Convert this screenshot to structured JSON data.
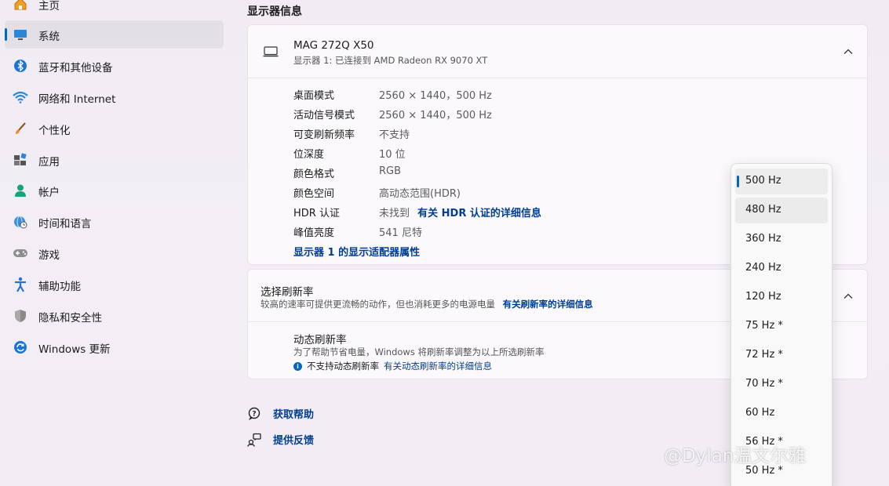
{
  "sidebar": {
    "items": [
      {
        "label": "主页",
        "icon": "home-icon"
      },
      {
        "label": "系统",
        "icon": "system-icon",
        "active": true
      },
      {
        "label": "蓝牙和其他设备",
        "icon": "bluetooth-icon"
      },
      {
        "label": "网络和 Internet",
        "icon": "wifi-icon"
      },
      {
        "label": "个性化",
        "icon": "brush-icon"
      },
      {
        "label": "应用",
        "icon": "apps-icon"
      },
      {
        "label": "帐户",
        "icon": "account-icon"
      },
      {
        "label": "时间和语言",
        "icon": "globe-clock-icon"
      },
      {
        "label": "游戏",
        "icon": "gamepad-icon"
      },
      {
        "label": "辅助功能",
        "icon": "accessibility-icon"
      },
      {
        "label": "隐私和安全性",
        "icon": "shield-icon"
      },
      {
        "label": "Windows 更新",
        "icon": "update-icon"
      }
    ]
  },
  "main": {
    "section_title": "显示器信息",
    "monitor": {
      "name": "MAG 272Q X50",
      "connection": "显示器 1: 已连接到 AMD Radeon RX 9070 XT"
    },
    "info_rows": [
      {
        "label": "桌面模式",
        "value": "2560 × 1440，500 Hz"
      },
      {
        "label": "活动信号模式",
        "value": "2560 × 1440，500 Hz"
      },
      {
        "label": "可变刷新频率",
        "value": "不支持"
      },
      {
        "label": "位深度",
        "value": "10 位"
      },
      {
        "label": "颜色格式",
        "value": "RGB"
      },
      {
        "label": "颜色空间",
        "value": "高动态范围(HDR)"
      },
      {
        "label": "HDR 认证",
        "value": "未找到",
        "link": "有关 HDR 认证的详细信息"
      },
      {
        "label": "峰值亮度",
        "value": "541 尼特"
      }
    ],
    "adapter_link": "显示器 1 的显示适配器属性",
    "refresh": {
      "title": "选择刷新率",
      "desc": "较高的速率可提供更流畅的动作，但也消耗更多的电源电量",
      "link": "有关刷新率的详细信息",
      "dynamic_title": "动态刷新率",
      "dynamic_desc": "为了帮助节省电量，Windows 将刷新率调整为以上所选刷新率",
      "dynamic_info": "不支持动态刷新率",
      "dynamic_link": "有关动态刷新率的详细信息"
    },
    "help": {
      "get_help": "获取帮助",
      "feedback": "提供反馈"
    }
  },
  "dropdown": {
    "selected": "500 Hz",
    "options": [
      "500 Hz",
      "480 Hz",
      "360 Hz",
      "240 Hz",
      "120 Hz",
      "75 Hz *",
      "72 Hz *",
      "70 Hz *",
      "60 Hz",
      "56 Hz *",
      "50 Hz *"
    ]
  },
  "watermark": "@Dylan温文尔雅",
  "colors": {
    "accent": "#0067c0",
    "link": "#003e92"
  }
}
